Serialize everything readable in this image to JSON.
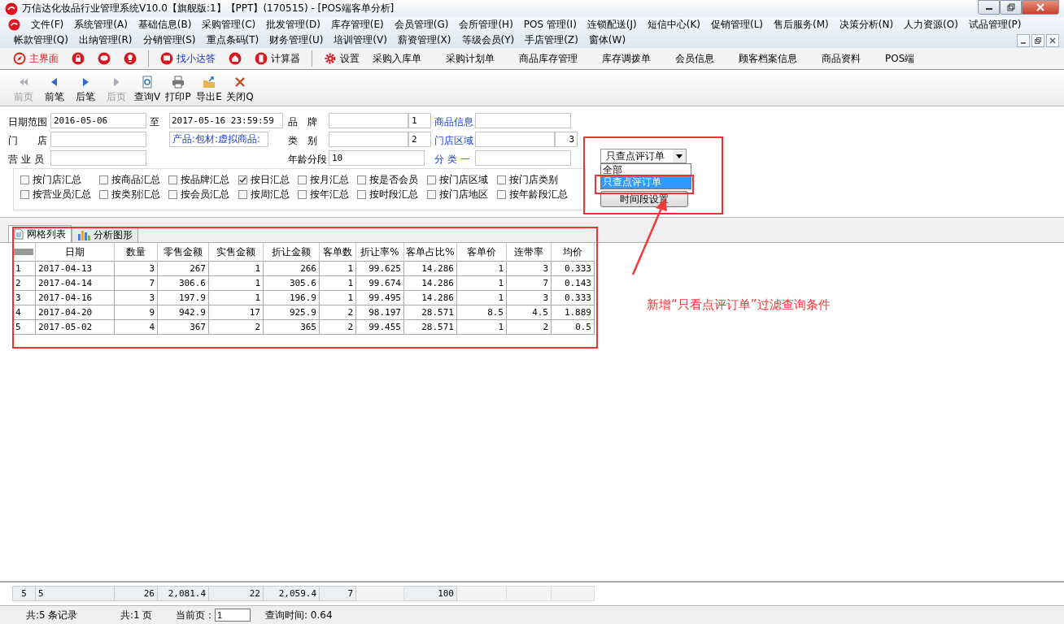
{
  "window": {
    "title": "万信达化妆品行业管理系统V10.0【旗舰版:1】【PPT】(170515) - [POS端客单分析]"
  },
  "menu_rows": [
    [
      "文件(F)",
      "系统管理(A)",
      "基础信息(B)",
      "采购管理(C)",
      "批发管理(D)",
      "库存管理(E)",
      "会员管理(G)",
      "会所管理(H)",
      "POS 管理(I)",
      "连锁配送(J)",
      "短信中心(K)",
      "促销管理(L)",
      "售后服务(M)",
      "决策分析(N)",
      "人力资源(O)",
      "试品管理(P)"
    ],
    [
      "帐款管理(Q)",
      "出纳管理(R)",
      "分销管理(S)",
      "重点条码(T)",
      "财务管理(U)",
      "培训管理(V)",
      "薪资管理(X)",
      "等级会员(Y)",
      "手店管理(Z)",
      "窗体(W)"
    ]
  ],
  "quick_bar": [
    {
      "label": "主界面",
      "kind": "compass"
    },
    {
      "kind": "lock"
    },
    {
      "kind": "chat"
    },
    {
      "kind": "bulb"
    },
    {
      "label": "找小达答",
      "kind": "monitor"
    },
    {
      "kind": "home"
    },
    {
      "label": "计算器",
      "kind": "calculator"
    },
    {
      "label": "设置",
      "kind": "gear"
    },
    {
      "label": "采购入库单",
      "kind": "text"
    },
    {
      "label": "采购计划单",
      "kind": "text"
    },
    {
      "label": "商品库存管理",
      "kind": "text"
    },
    {
      "label": "库存调拨单",
      "kind": "text"
    },
    {
      "label": "会员信息",
      "kind": "text"
    },
    {
      "label": "顾客档案信息",
      "kind": "text"
    },
    {
      "label": "商品资料",
      "kind": "text"
    },
    {
      "label": "POS端",
      "kind": "text"
    }
  ],
  "toolbar": [
    {
      "label": "前页",
      "kind": "first",
      "disabled": true
    },
    {
      "label": "前笔",
      "kind": "prev",
      "disabled": false
    },
    {
      "label": "后笔",
      "kind": "next",
      "disabled": false
    },
    {
      "label": "后页",
      "kind": "last",
      "disabled": true
    },
    {
      "label": "查询V",
      "kind": "query",
      "disabled": false
    },
    {
      "label": "打印P",
      "kind": "print",
      "disabled": false
    },
    {
      "label": "导出E",
      "kind": "export",
      "disabled": false
    },
    {
      "label": "关闭Q",
      "kind": "close",
      "disabled": false
    }
  ],
  "filters": {
    "date_label": "日期范围",
    "date_from": "2016-05-06",
    "to_label": "至",
    "date_to": "2017-05-16 23:59:59",
    "brand_label": "品　牌",
    "brand_code": "1",
    "goods_label": "商品信息",
    "store_label": "门　　店",
    "product_path": "产品:包材:虚拟商品:",
    "category_label": "类　别",
    "category_code": "2",
    "region_label": "门店区域",
    "region_code": "3",
    "clerk_label": "营 业 员",
    "age_label": "年龄分段",
    "age_value": "10",
    "class_label": "分 类 一"
  },
  "group_options": [
    {
      "label": "按门店汇总",
      "checked": false
    },
    {
      "label": "按商品汇总",
      "checked": false
    },
    {
      "label": "按品牌汇总",
      "checked": false
    },
    {
      "label": "按日汇总",
      "checked": true
    },
    {
      "label": "按月汇总",
      "checked": false
    },
    {
      "label": "按是否会员",
      "checked": false
    },
    {
      "label": "按门店区域",
      "checked": false
    },
    {
      "label": "按门店类别",
      "checked": false
    },
    {
      "label": "按营业员汇总",
      "checked": false
    },
    {
      "label": "按类别汇总",
      "checked": false
    },
    {
      "label": "按会员汇总",
      "checked": false
    },
    {
      "label": "按周汇总",
      "checked": false
    },
    {
      "label": "按年汇总",
      "checked": false
    },
    {
      "label": "按时段汇总",
      "checked": false
    },
    {
      "label": "按门店地区",
      "checked": false
    },
    {
      "label": "按年龄段汇总",
      "checked": false
    }
  ],
  "order_filter": {
    "value": "只查点评订单",
    "options": [
      {
        "label": "全部",
        "selected": false
      },
      {
        "label": "只查点评订单",
        "selected": true
      }
    ]
  },
  "period_button": "时间段设置",
  "tabs": [
    {
      "label": "网格列表",
      "kind": "doc",
      "selected": true
    },
    {
      "label": "分析图形",
      "kind": "chart",
      "selected": false
    }
  ],
  "table": {
    "columns": [
      "",
      "日期",
      "数量",
      "零售金额",
      "实售金额",
      "折让金额",
      "客单数",
      "折让率%",
      "客单占比%",
      "客单价",
      "连带率",
      "均价"
    ],
    "rows": [
      [
        "1",
        "2017-04-13",
        "3",
        "267",
        "1",
        "266",
        "1",
        "99.625",
        "14.286",
        "1",
        "3",
        "0.333"
      ],
      [
        "2",
        "2017-04-14",
        "7",
        "306.6",
        "1",
        "305.6",
        "1",
        "99.674",
        "14.286",
        "1",
        "7",
        "0.143"
      ],
      [
        "3",
        "2017-04-16",
        "3",
        "197.9",
        "1",
        "196.9",
        "1",
        "99.495",
        "14.286",
        "1",
        "3",
        "0.333"
      ],
      [
        "4",
        "2017-04-20",
        "9",
        "942.9",
        "17",
        "925.9",
        "2",
        "98.197",
        "28.571",
        "8.5",
        "4.5",
        "1.889"
      ],
      [
        "5",
        "2017-05-02",
        "4",
        "367",
        "2",
        "365",
        "2",
        "99.455",
        "28.571",
        "1",
        "2",
        "0.5"
      ]
    ],
    "totals": [
      {
        "text": "5",
        "empty": false
      },
      {
        "text": "5",
        "empty": false
      },
      {
        "text": "26",
        "empty": false
      },
      {
        "text": "2,081.4",
        "empty": false
      },
      {
        "text": "22",
        "empty": false
      },
      {
        "text": "2,059.4",
        "empty": false
      },
      {
        "text": "7",
        "empty": false
      },
      {
        "empty": true
      },
      {
        "text": "100",
        "empty": false
      },
      {
        "empty": true
      },
      {
        "empty": true
      },
      {
        "empty": true
      }
    ]
  },
  "status_bar": {
    "records": "共:5 条记录",
    "pages": "共:1 页",
    "page_label": "当前页：",
    "page_value": "1",
    "query_time": "查询时间: 0.64"
  },
  "annotation": "新增“只看点评订单”过滤查询条件"
}
